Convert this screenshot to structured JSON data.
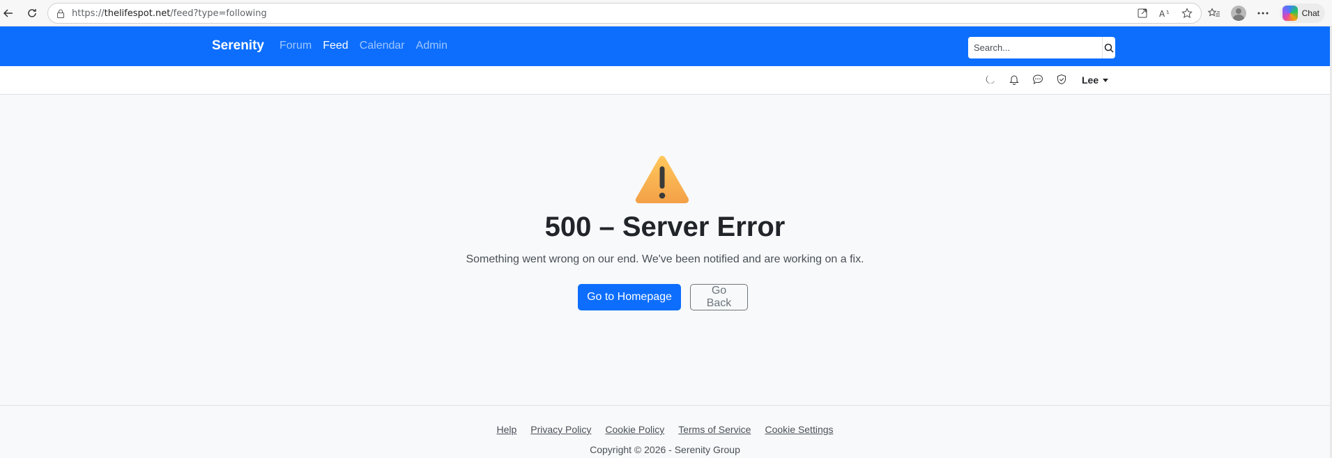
{
  "browser": {
    "url_scheme": "https://",
    "url_host": "thelifespot.net",
    "url_path": "/feed?type=following",
    "chat_label": "Chat"
  },
  "navbar": {
    "brand": "Serenity",
    "links": [
      {
        "label": "Forum",
        "active": false
      },
      {
        "label": "Feed",
        "active": true
      },
      {
        "label": "Calendar",
        "active": false
      },
      {
        "label": "Admin",
        "active": false
      }
    ],
    "search_placeholder": "Search..."
  },
  "subbar": {
    "user_name": "Lee",
    "icons": [
      "moon-icon",
      "bell-icon",
      "chat-bubble-icon",
      "shield-icon"
    ]
  },
  "error": {
    "icon": "warning-icon",
    "title": "500 – Server Error",
    "message": "Something went wrong on our end. We've been notified and are working on a fix.",
    "primary_button": "Go to Homepage",
    "secondary_button": "Go Back"
  },
  "footer": {
    "links": [
      "Help",
      "Privacy Policy",
      "Cookie Policy",
      "Terms of Service",
      "Cookie Settings"
    ],
    "copyright": "Copyright © 2026 - Serenity Group"
  },
  "colors": {
    "primary": "#0d6efd",
    "background": "#f8f9fa",
    "warning": "#f5a623"
  }
}
